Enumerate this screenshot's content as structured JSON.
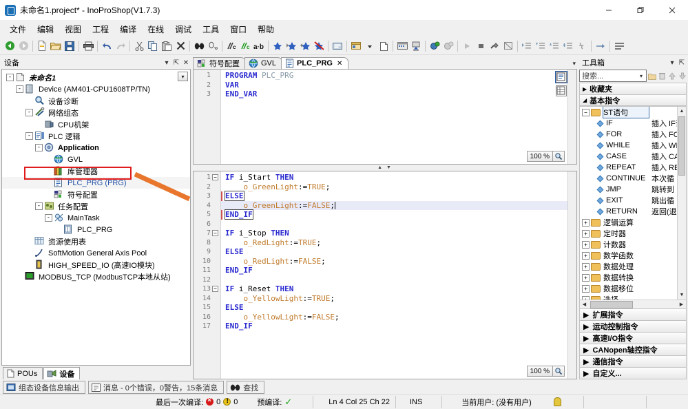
{
  "window": {
    "title": "未命名1.project* - InoProShop(V1.7.3)",
    "minimize_label": "—",
    "maximize_label": "❐",
    "close_label": "✕"
  },
  "menubar": {
    "items": [
      {
        "label": "文件"
      },
      {
        "label": "编辑"
      },
      {
        "label": "视图"
      },
      {
        "label": "工程"
      },
      {
        "label": "编译"
      },
      {
        "label": "在线"
      },
      {
        "label": "调试"
      },
      {
        "label": "工具"
      },
      {
        "label": "窗口"
      },
      {
        "label": "帮助"
      }
    ]
  },
  "toolbar": {
    "items": [
      {
        "name": "back-icon"
      },
      {
        "name": "forward-icon"
      },
      {
        "name": "sep"
      },
      {
        "name": "new-file-icon"
      },
      {
        "name": "open-folder-icon"
      },
      {
        "name": "save-icon"
      },
      {
        "name": "sep"
      },
      {
        "name": "print-icon"
      },
      {
        "name": "sep"
      },
      {
        "name": "undo-icon"
      },
      {
        "name": "redo-icon"
      },
      {
        "name": "sep"
      },
      {
        "name": "cut-icon"
      },
      {
        "name": "copy-icon"
      },
      {
        "name": "paste-icon"
      },
      {
        "name": "delete-icon"
      },
      {
        "name": "sep"
      },
      {
        "name": "find-icon"
      },
      {
        "name": "replace-icon"
      },
      {
        "name": "sep"
      },
      {
        "name": "comment-icon"
      },
      {
        "name": "uncomment-icon"
      },
      {
        "name": "toggle-case-icon"
      },
      {
        "name": "sep"
      },
      {
        "name": "bookmark-add-icon"
      },
      {
        "name": "bookmark-next-icon"
      },
      {
        "name": "bookmark-prev-icon"
      },
      {
        "name": "bookmark-clear-icon"
      },
      {
        "name": "sep"
      },
      {
        "name": "build-icon"
      },
      {
        "name": "sep"
      },
      {
        "name": "login-icon"
      },
      {
        "name": "login-dropdown-icon"
      },
      {
        "name": "logout-icon"
      },
      {
        "name": "sep"
      },
      {
        "name": "download-icon"
      },
      {
        "name": "online-change-icon"
      },
      {
        "name": "sep"
      },
      {
        "name": "start-debug-icon"
      },
      {
        "name": "stop-debug-icon"
      },
      {
        "name": "sep"
      },
      {
        "name": "run-icon"
      },
      {
        "name": "stop-icon"
      },
      {
        "name": "reset-icon"
      },
      {
        "name": "single-cycle-icon"
      },
      {
        "name": "sep"
      },
      {
        "name": "step-over-icon"
      },
      {
        "name": "step-into-icon"
      },
      {
        "name": "step-out-icon"
      },
      {
        "name": "step-to-icon"
      },
      {
        "name": "breakpoint-icon"
      },
      {
        "name": "sep"
      },
      {
        "name": "next-statement-icon"
      },
      {
        "name": "sep"
      },
      {
        "name": "write-values-icon"
      }
    ]
  },
  "devices_panel": {
    "title": "设备",
    "buttons": {
      "dropdown": "▾",
      "pin": "⇱",
      "close": "✕"
    },
    "filter_dropdown": "▾",
    "tree": [
      {
        "indent": 0,
        "expander": "-",
        "icon": "project-icon",
        "label": "未命名1",
        "style": "bold-italic"
      },
      {
        "indent": 1,
        "expander": "-",
        "icon": "device-icon",
        "label": "Device (AM401-CPU1608TP/TN)",
        "style": "normal"
      },
      {
        "indent": 2,
        "expander": "",
        "icon": "diagnosis-icon",
        "label": "设备诊断",
        "style": "normal"
      },
      {
        "indent": 2,
        "expander": "-",
        "icon": "network-icon",
        "label": "网络组态",
        "style": "normal"
      },
      {
        "indent": 3,
        "expander": "",
        "icon": "cpu-rack-icon",
        "label": "CPU机架",
        "style": "normal"
      },
      {
        "indent": 2,
        "expander": "-",
        "icon": "plc-logic-icon",
        "label": "PLC 逻辑",
        "style": "normal"
      },
      {
        "indent": 3,
        "expander": "-",
        "icon": "application-icon",
        "label": "Application",
        "style": "bold"
      },
      {
        "indent": 4,
        "expander": "",
        "icon": "gvl-icon",
        "label": "GVL",
        "style": "normal"
      },
      {
        "indent": 4,
        "expander": "",
        "icon": "library-icon",
        "label": "库管理器",
        "style": "normal"
      },
      {
        "indent": 4,
        "expander": "",
        "icon": "prg-icon",
        "label": "PLC_PRG (PRG)",
        "style": "blue",
        "highlight": true
      },
      {
        "indent": 4,
        "expander": "",
        "icon": "symbol-config-icon",
        "label": "符号配置",
        "style": "normal"
      },
      {
        "indent": 3,
        "expander": "-",
        "icon": "task-config-icon",
        "label": "任务配置",
        "style": "normal"
      },
      {
        "indent": 4,
        "expander": "-",
        "icon": "task-icon",
        "label": "MainTask",
        "style": "normal"
      },
      {
        "indent": 5,
        "expander": "",
        "icon": "prg-ref-icon",
        "label": "PLC_PRG",
        "style": "normal"
      },
      {
        "indent": 2,
        "expander": "",
        "icon": "resource-icon",
        "label": "资源使用表",
        "style": "normal"
      },
      {
        "indent": 2,
        "expander": "",
        "icon": "axis-pool-icon",
        "label": "SoftMotion General Axis Pool",
        "style": "normal"
      },
      {
        "indent": 2,
        "expander": "",
        "icon": "hsio-icon",
        "label": "HIGH_SPEED_IO (高速IO模块)",
        "style": "normal"
      },
      {
        "indent": 1,
        "expander": "",
        "icon": "modbus-icon",
        "label": "MODBUS_TCP (ModbusTCP本地从站)",
        "style": "normal"
      }
    ],
    "tabs": [
      {
        "label": "POUs",
        "icon": "pous-icon",
        "active": false
      },
      {
        "label": "设备",
        "icon": "devices-icon",
        "active": true
      }
    ]
  },
  "editor": {
    "tabs": [
      {
        "label": "符号配置",
        "icon": "symbol-config-icon",
        "active": false,
        "closable": false
      },
      {
        "label": "GVL",
        "icon": "gvl-icon",
        "active": false,
        "closable": false
      },
      {
        "label": "PLC_PRG",
        "icon": "prg-icon",
        "active": true,
        "closable": true,
        "close_label": "✕"
      }
    ],
    "tab_menu_icon": "▾",
    "declaration": {
      "zoom": "100 %",
      "zoom_icon": "zoom-icon",
      "lines": [
        {
          "n": "1",
          "fold": "",
          "tokens": [
            {
              "t": "PROGRAM",
              "c": "kw"
            },
            {
              "t": " ",
              "c": "plain"
            },
            {
              "t": "PLC_PRG",
              "c": "id"
            }
          ]
        },
        {
          "n": "2",
          "fold": "",
          "tokens": [
            {
              "t": "VAR",
              "c": "kw"
            }
          ]
        },
        {
          "n": "3",
          "fold": "",
          "tokens": [
            {
              "t": "END_VAR",
              "c": "kw"
            }
          ]
        }
      ]
    },
    "implementation": {
      "zoom": "100 %",
      "zoom_icon": "zoom-icon",
      "current_line": 4,
      "lines": [
        {
          "n": "1",
          "fold": "-",
          "indent": 0,
          "tokens": [
            {
              "t": "IF",
              "c": "kw"
            },
            {
              "t": " ",
              "c": "plain"
            },
            {
              "t": "i_Start",
              "c": "plain"
            },
            {
              "t": " ",
              "c": "plain"
            },
            {
              "t": "THEN",
              "c": "kw"
            }
          ]
        },
        {
          "n": "2",
          "fold": "",
          "indent": 1,
          "tokens": [
            {
              "t": "o_GreenLight",
              "c": "ident"
            },
            {
              "t": ":=",
              "c": "plain"
            },
            {
              "t": "TRUE",
              "c": "lit"
            },
            {
              "t": ";",
              "c": "plain"
            }
          ]
        },
        {
          "n": "3",
          "fold": "",
          "indent": 0,
          "tokens": [
            {
              "t": "ELSE",
              "c": "kwbox"
            }
          ]
        },
        {
          "n": "4",
          "fold": "",
          "indent": 1,
          "tokens": [
            {
              "t": "o_GreenLight",
              "c": "ident"
            },
            {
              "t": ":=",
              "c": "plain"
            },
            {
              "t": "FALSE",
              "c": "lit"
            },
            {
              "t": ";",
              "c": "plain"
            }
          ]
        },
        {
          "n": "5",
          "fold": "",
          "indent": 0,
          "tokens": [
            {
              "t": "END_IF",
              "c": "kwbox"
            }
          ]
        },
        {
          "n": "6",
          "fold": "",
          "indent": 0,
          "tokens": []
        },
        {
          "n": "7",
          "fold": "-",
          "indent": 0,
          "tokens": [
            {
              "t": "IF",
              "c": "kw"
            },
            {
              "t": " ",
              "c": "plain"
            },
            {
              "t": "i_Stop",
              "c": "plain"
            },
            {
              "t": " ",
              "c": "plain"
            },
            {
              "t": "THEN",
              "c": "kw"
            }
          ]
        },
        {
          "n": "8",
          "fold": "",
          "indent": 1,
          "tokens": [
            {
              "t": "o_RedLight",
              "c": "ident"
            },
            {
              "t": ":=",
              "c": "plain"
            },
            {
              "t": "TRUE",
              "c": "lit"
            },
            {
              "t": ";",
              "c": "plain"
            }
          ]
        },
        {
          "n": "9",
          "fold": "",
          "indent": 0,
          "tokens": [
            {
              "t": "ELSE",
              "c": "kw"
            }
          ]
        },
        {
          "n": "10",
          "fold": "",
          "indent": 1,
          "tokens": [
            {
              "t": "o_RedLight",
              "c": "ident"
            },
            {
              "t": ":=",
              "c": "plain"
            },
            {
              "t": "FALSE",
              "c": "lit"
            },
            {
              "t": ";",
              "c": "plain"
            }
          ]
        },
        {
          "n": "11",
          "fold": "",
          "indent": 0,
          "tokens": [
            {
              "t": "END_IF",
              "c": "kw"
            }
          ]
        },
        {
          "n": "12",
          "fold": "",
          "indent": 0,
          "tokens": []
        },
        {
          "n": "13",
          "fold": "-",
          "indent": 0,
          "tokens": [
            {
              "t": "IF",
              "c": "kw"
            },
            {
              "t": " ",
              "c": "plain"
            },
            {
              "t": "i_Reset",
              "c": "plain"
            },
            {
              "t": " ",
              "c": "plain"
            },
            {
              "t": "THEN",
              "c": "kw"
            }
          ]
        },
        {
          "n": "14",
          "fold": "",
          "indent": 1,
          "tokens": [
            {
              "t": "o_YellowLight",
              "c": "ident"
            },
            {
              "t": ":=",
              "c": "plain"
            },
            {
              "t": "TRUE",
              "c": "lit"
            },
            {
              "t": ";",
              "c": "plain"
            }
          ]
        },
        {
          "n": "15",
          "fold": "",
          "indent": 0,
          "tokens": [
            {
              "t": "ELSE",
              "c": "kw"
            }
          ]
        },
        {
          "n": "16",
          "fold": "",
          "indent": 1,
          "tokens": [
            {
              "t": "o_YellowLight",
              "c": "ident"
            },
            {
              "t": ":=",
              "c": "plain"
            },
            {
              "t": "FALSE",
              "c": "lit"
            },
            {
              "t": ";",
              "c": "plain"
            }
          ]
        },
        {
          "n": "17",
          "fold": "",
          "indent": 0,
          "tokens": [
            {
              "t": "END_IF",
              "c": "kw"
            }
          ]
        }
      ]
    }
  },
  "toolbox": {
    "title": "工具箱",
    "buttons": {
      "dropdown": "▾",
      "pin": "⇱"
    },
    "search_placeholder": "搜索...",
    "search_value": "",
    "search_dropdown": "▾",
    "tool_icons": [
      "new-folder-icon",
      "delete-item-icon",
      "move-up-icon",
      "move-down-icon"
    ],
    "sections": [
      {
        "label": "收藏夹",
        "expanded": false,
        "marker": "▶"
      },
      {
        "label": "基本指令",
        "expanded": true,
        "marker": "◢"
      }
    ],
    "tree": {
      "root": {
        "label": "ST语句",
        "expander": "-",
        "selected": true
      },
      "items": [
        {
          "name": "IF",
          "desc": "插入 IF语"
        },
        {
          "name": "FOR",
          "desc": "插入 FO"
        },
        {
          "name": "WHILE",
          "desc": "插入 WH"
        },
        {
          "name": "CASE",
          "desc": "插入 CA"
        },
        {
          "name": "REPEAT",
          "desc": "插入 RE"
        },
        {
          "name": "CONTINUE",
          "desc": "本次循"
        },
        {
          "name": "JMP",
          "desc": "跳转到"
        },
        {
          "name": "EXIT",
          "desc": "跳出循"
        },
        {
          "name": "RETURN",
          "desc": "返回(退"
        }
      ],
      "folders": [
        {
          "label": "逻辑运算",
          "expander": "+"
        },
        {
          "label": "定时器",
          "expander": "+"
        },
        {
          "label": "计数器",
          "expander": "+"
        },
        {
          "label": "数学函数",
          "expander": "+"
        },
        {
          "label": "数据处理",
          "expander": "+"
        },
        {
          "label": "数据转换",
          "expander": "+"
        },
        {
          "label": "数据移位",
          "expander": "+"
        },
        {
          "label": "选择",
          "expander": "+"
        }
      ]
    },
    "bottom_sections": [
      {
        "label": "扩展指令",
        "marker": "▶"
      },
      {
        "label": "运动控制指令",
        "marker": "▶"
      },
      {
        "label": "高速I/O指令",
        "marker": "▶"
      },
      {
        "label": "CANopen轴控指令",
        "marker": "▶"
      },
      {
        "label": "通信指令",
        "marker": "▶"
      },
      {
        "label": "自定义...",
        "marker": "▶"
      }
    ]
  },
  "message_tabs": [
    {
      "label": "组态设备信息输出",
      "icon": "device-info-icon",
      "active": false
    },
    {
      "label": "消息 - 0个错误，0警告，15条消息",
      "icon": "messages-icon",
      "active": false
    },
    {
      "label": "查找",
      "icon": "find-icon",
      "active": false
    }
  ],
  "statusbar": {
    "last_build_label": "最后一次编译:",
    "error_count": "0",
    "warning_count": "0",
    "precompile_label": "预编译:",
    "precompile_state": "✓",
    "cursor": "Ln 4   Col 25   Ch 22",
    "insert_mode": "INS",
    "current_user": "当前用户: (没有用户)",
    "user_icon": "bulb-icon"
  },
  "colors": {
    "accent_blue": "#1f4fa8",
    "highlight_red": "#e01b1b",
    "arrow_orange": "#e8762c",
    "keyword": "#2a2ad0",
    "literal": "#c07a2a",
    "error_red": "#d61a1a",
    "warning_yellow": "#e8c21a",
    "ok_green": "#19a319"
  }
}
